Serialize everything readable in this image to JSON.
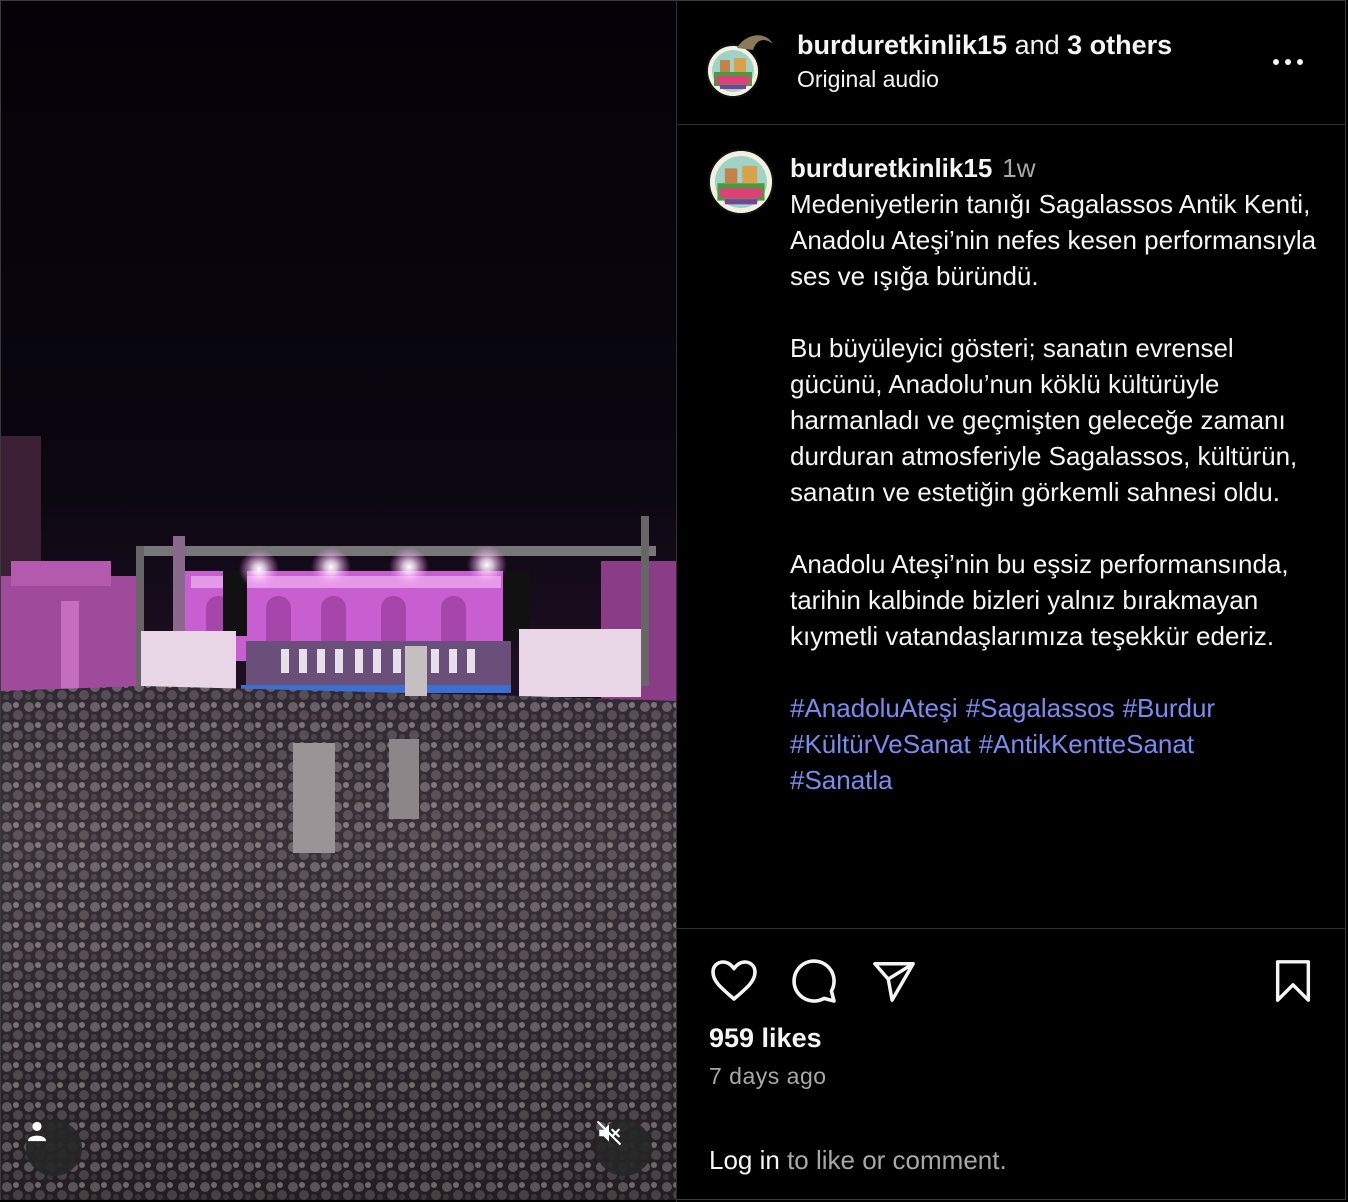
{
  "header": {
    "username": "burduretkinlik15",
    "and_text": " and ",
    "others": "3 others",
    "audio": "Original audio"
  },
  "caption": {
    "username": "burduretkinlik15",
    "time": "1w",
    "paragraphs": [
      "Medeniyetlerin tanığı Sagalassos Antik Kenti, Anadolu Ateşi’nin nefes kesen performansıyla ses ve ışığa büründü.",
      "Bu büyüleyici gösteri; sanatın evrensel gücünü, Anadolu’nun köklü kültürüyle harmanladı ve geçmişten geleceğe zamanı durduran atmosferiyle Sagalassos, kültürün, sanatın ve estetiğin görkemli sahnesi oldu.",
      "Anadolu Ateşi’nin bu eşsiz performansında, tarihin kalbinde bizleri yalnız bırakmayan kıymetli vatandaşlarımıza teşekkür ederiz."
    ],
    "hashtags": [
      "#AnadoluAteşi",
      "#Sagalassos",
      "#Burdur",
      "#KültürVeSanat",
      "#AntikKentteSanat",
      "#Sanatla"
    ]
  },
  "stats": {
    "likes": "959 likes",
    "ago": "7 days ago"
  },
  "login": {
    "link": "Log in",
    "rest": " to like or comment."
  },
  "icons": {
    "user": "user-icon",
    "mute": "muted-speaker-icon",
    "like": "heart-icon",
    "comment": "comment-icon",
    "share": "send-icon",
    "save": "bookmark-icon",
    "more": "more-options-icon"
  },
  "colors": {
    "background": "#000000",
    "text": "#f5f5f5",
    "secondary": "#a8a8a8",
    "hashtag": "#7b8cf0",
    "stage_light": "#d86ad8"
  }
}
